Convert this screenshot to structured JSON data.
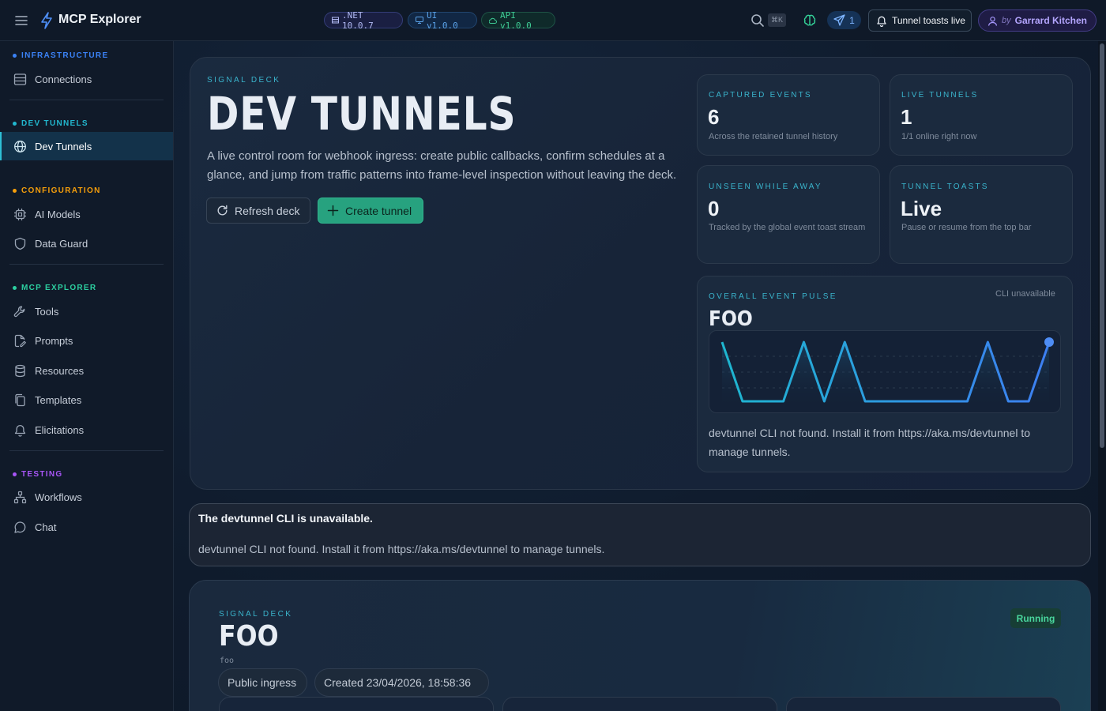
{
  "topbar": {
    "title": "MCP Explorer",
    "pills": {
      "net": ".NET 10.0.7",
      "ui": "UI v1.0.0",
      "api": "API v1.0.0"
    },
    "kbd": "⌘K",
    "send_count": "1",
    "toast_label": "Tunnel toasts live",
    "user_by": "by",
    "user_name": "Garrard Kitchen"
  },
  "sidebar": {
    "sections": {
      "infrastructure": {
        "label": "INFRASTRUCTURE",
        "color": "#3b82f6"
      },
      "dev_tunnels": {
        "label": "DEV TUNNELS",
        "color": "#22b8cf"
      },
      "configuration": {
        "label": "CONFIGURATION",
        "color": "#f59e0b"
      },
      "mcp_explorer": {
        "label": "MCP EXPLORER",
        "color": "#2ccfa0"
      },
      "testing": {
        "label": "TESTING",
        "color": "#a855f7"
      }
    },
    "items": {
      "connections": "Connections",
      "dev_tunnels": "Dev Tunnels",
      "ai_models": "AI Models",
      "data_guard": "Data Guard",
      "tools": "Tools",
      "prompts": "Prompts",
      "resources": "Resources",
      "templates": "Templates",
      "elicitations": "Elicitations",
      "workflows": "Workflows",
      "chat": "Chat"
    }
  },
  "hero": {
    "eyebrow": "SIGNAL DECK",
    "title": "DEV TUNNELS",
    "description": "A live control room for webhook ingress: create public callbacks, confirm schedules at a glance, and jump from traffic patterns into frame-level inspection without leaving the deck.",
    "refresh_label": "Refresh deck",
    "create_label": "Create tunnel"
  },
  "stats": {
    "captured": {
      "label": "CAPTURED EVENTS",
      "value": "6",
      "sub": "Across the retained tunnel history"
    },
    "live": {
      "label": "LIVE TUNNELS",
      "value": "1",
      "sub": "1/1 online right now"
    },
    "unseen": {
      "label": "UNSEEN WHILE AWAY",
      "value": "0",
      "sub": "Tracked by the global event toast stream"
    },
    "toasts": {
      "label": "TUNNEL TOASTS",
      "value": "Live",
      "sub": "Pause or resume from the top bar"
    }
  },
  "pulse": {
    "label": "OVERALL EVENT PULSE",
    "status": "CLI unavailable",
    "title": "FOO",
    "message": "devtunnel CLI not found. Install it from https://aka.ms/devtunnel to manage tunnels.",
    "series": [
      1,
      0,
      0,
      0,
      1,
      0,
      1,
      0,
      0,
      0,
      0,
      0,
      0,
      1,
      0,
      0,
      1
    ]
  },
  "alert": {
    "title": "The devtunnel CLI is unavailable.",
    "message": "devtunnel CLI not found. Install it from https://aka.ms/devtunnel to manage tunnels."
  },
  "tunnel": {
    "eyebrow": "SIGNAL DECK",
    "name": "FOO",
    "id": "foo",
    "status": "Running",
    "chips": {
      "ingress": "Public ingress",
      "created": "Created 23/04/2026, 18:58:36"
    }
  }
}
